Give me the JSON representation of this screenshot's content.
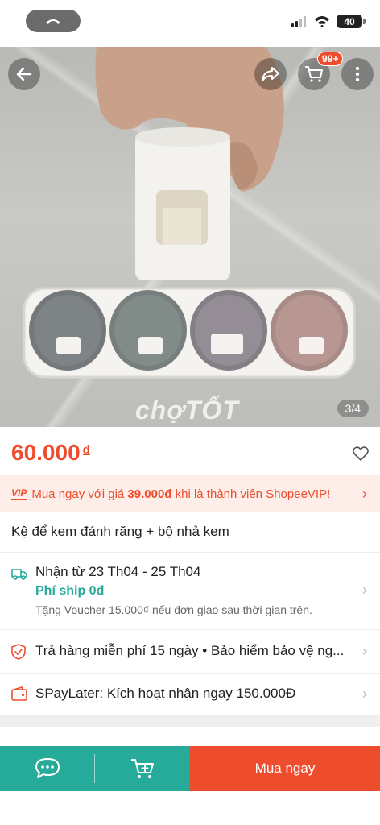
{
  "status_bar": {
    "battery": "40"
  },
  "hero": {
    "image_counter": "3/4",
    "watermark": "chợTỐT",
    "cart_badge": "99+"
  },
  "product": {
    "price": "60.000",
    "currency": "đ",
    "title": "Kệ để kem đánh răng + bộ nhả kem"
  },
  "vip": {
    "tag": "VIP",
    "text_before": "Mua ngay với giá ",
    "vip_price": "39.000đ",
    "text_after": " khi là thành viên ShopeeVIP!"
  },
  "shipping": {
    "delivery": "Nhận từ 23 Th04 - 25 Th04",
    "fee": "Phí ship 0đ",
    "voucher": "Tặng Voucher 15.000₫ nếu đơn giao sau thời gian trên."
  },
  "guarantee": {
    "text": "Trả hàng miễn phí 15 ngày  •  Bảo hiểm bảo vệ ng..."
  },
  "spaylater": {
    "text": "SPayLater: Kích hoạt nhận ngay 150.000Đ"
  },
  "bottom_bar": {
    "buy_now": "Mua ngay"
  },
  "colors": {
    "accent": "#ee4d2d",
    "teal": "#26aa99"
  }
}
